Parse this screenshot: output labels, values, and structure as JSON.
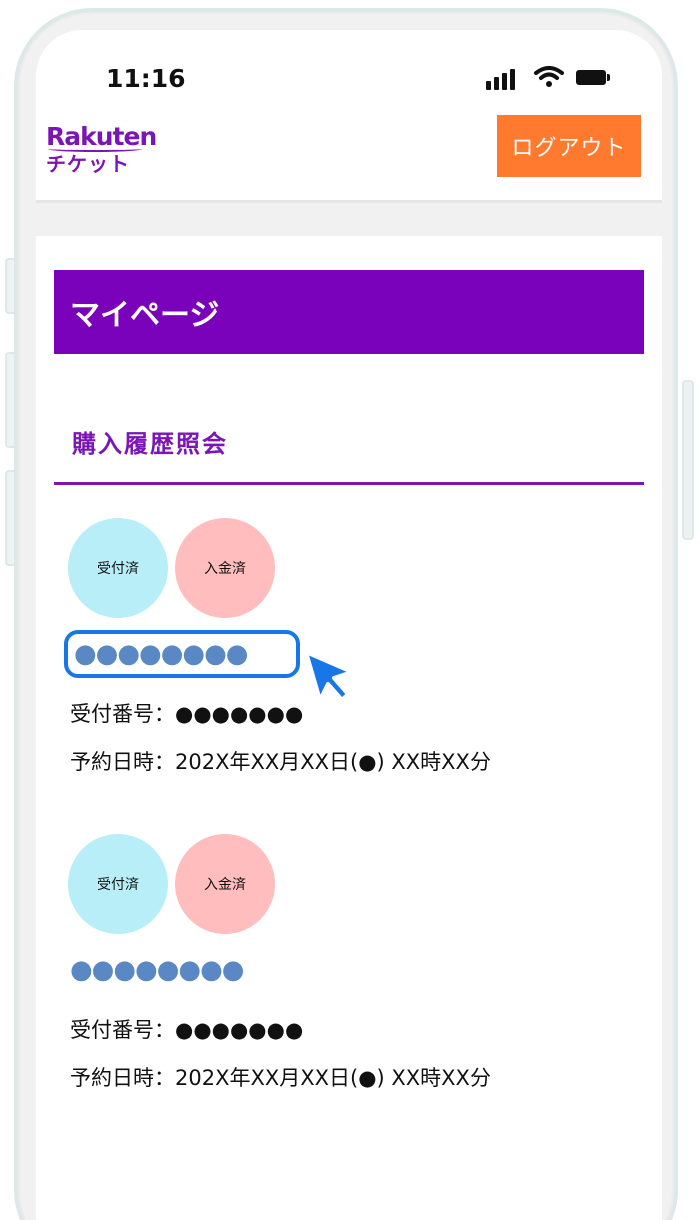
{
  "status_bar": {
    "time": "11:16"
  },
  "header": {
    "logo_top": "Rakuten",
    "logo_bottom": "チケット",
    "logout_label": "ログアウト"
  },
  "page": {
    "title": "マイページ",
    "section_title": "購入履歴照会"
  },
  "orders": [
    {
      "badge_received": "受付済",
      "badge_paid": "入金済",
      "ticket_name": "●●●●●●●●",
      "reception_line": "受付番号：●●●●●●●",
      "reservation_line": "予約日時：202X年XX月XX日(●) XX時XX分"
    },
    {
      "badge_received": "受付済",
      "badge_paid": "入金済",
      "ticket_name": "●●●●●●●●",
      "reception_line": "受付番号：●●●●●●●",
      "reservation_line": "予約日時：202X年XX月XX日(●) XX時XX分"
    }
  ],
  "colors": {
    "brand_purple": "#7a02ba",
    "logout_orange": "#ff7a2f",
    "highlight_blue": "#1777e6",
    "badge_received": "#b8eef8",
    "badge_paid": "#ffbdbd",
    "ticket_name_blue": "#5a88c5"
  },
  "icons": [
    "signal-icon",
    "wifi-icon",
    "battery-icon",
    "pointer-cursor-icon"
  ]
}
